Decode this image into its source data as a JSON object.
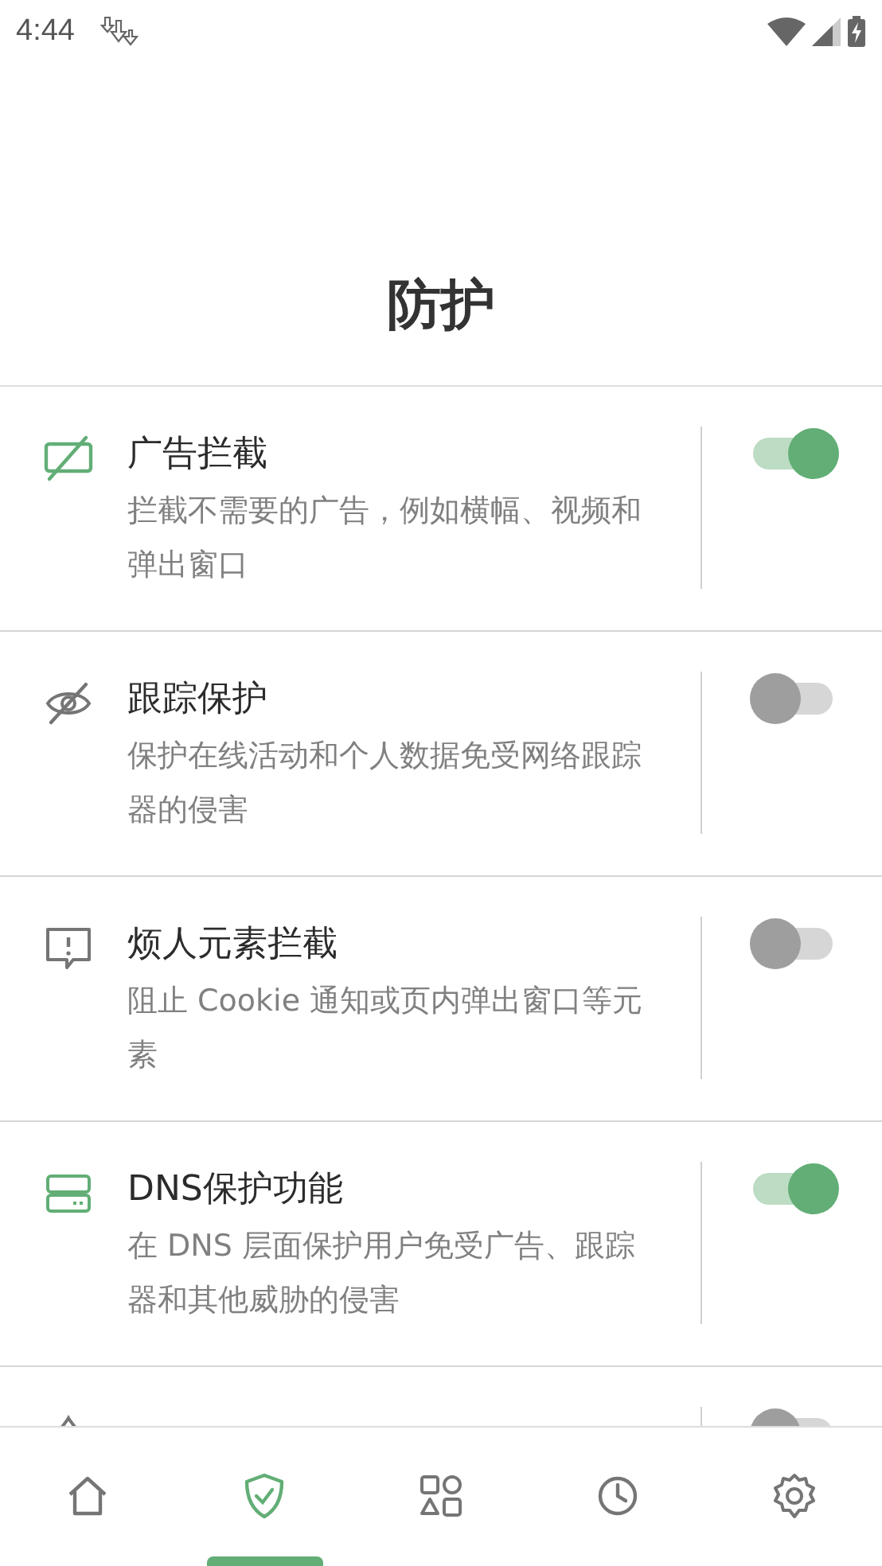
{
  "status_bar": {
    "time": "4:44"
  },
  "title": "防护",
  "features": [
    {
      "kind": "ad",
      "title": "广告拦截",
      "description": "拦截不需要的广告，例如横幅、视频和弹出窗口",
      "on": true
    },
    {
      "kind": "tracking",
      "title": "跟踪保护",
      "description": "保护在线活动和个人数据免受网络跟踪器的侵害",
      "on": false
    },
    {
      "kind": "annoyance",
      "title": "烦人元素拦截",
      "description": "阻止 Cookie 通知或页内弹出窗口等元素",
      "on": false
    },
    {
      "kind": "dns",
      "title": "DNS保护功能",
      "description": "在 DNS 层面保护用户免受广告、跟踪器和其他威胁的侵害",
      "on": true
    },
    {
      "kind": "firewall",
      "on": false
    }
  ],
  "nav": [
    {
      "kind": "home",
      "selected": false
    },
    {
      "kind": "protection",
      "selected": true
    },
    {
      "kind": "apps",
      "selected": false
    },
    {
      "kind": "history",
      "selected": false
    },
    {
      "kind": "settings",
      "selected": false
    }
  ]
}
